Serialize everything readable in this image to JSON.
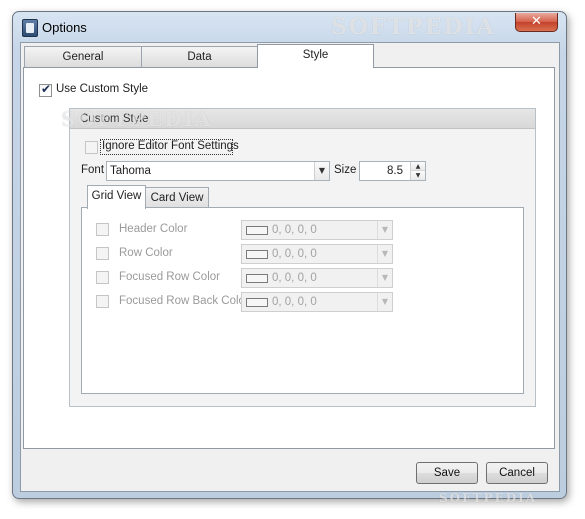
{
  "window": {
    "title": "Options",
    "close_glyph": "✕"
  },
  "tabs": [
    {
      "label": "General",
      "active": false
    },
    {
      "label": "Data",
      "active": false
    },
    {
      "label": "Style",
      "active": true
    }
  ],
  "style_page": {
    "use_custom_style": {
      "label": "Use Custom Style",
      "checked": true
    },
    "group_title": "Custom Style",
    "ignore_editor_font": {
      "label": "Ignore Editor Font Settings",
      "checked": false
    },
    "font": {
      "label": "Font",
      "value": "Tahoma"
    },
    "size": {
      "label": "Size",
      "value": "8.5"
    },
    "inner_tabs": [
      {
        "label": "Grid View",
        "active": true
      },
      {
        "label": "Card View",
        "active": false
      }
    ],
    "color_rows": [
      {
        "label": "Header Color",
        "value": "0, 0, 0, 0",
        "checked": false
      },
      {
        "label": "Row Color",
        "value": "0, 0, 0, 0",
        "checked": false
      },
      {
        "label": "Focused Row Color",
        "value": "0, 0, 0, 0",
        "checked": false
      },
      {
        "label": "Focused Row Back Color",
        "value": "0, 0, 0, 0",
        "checked": false
      }
    ]
  },
  "footer": {
    "save_label": "Save",
    "cancel_label": "Cancel"
  },
  "watermark": "SOFTPEDIA",
  "icons": {
    "app": "options-app-icon",
    "close": "close-icon",
    "dropdown": "chevron-down-icon",
    "spin_up": "spin-up-icon",
    "spin_down": "spin-down-icon"
  },
  "colors": {
    "close_button": "#c4412a",
    "window_frame": "#c6d6e8",
    "page_bg": "#ffffff"
  }
}
